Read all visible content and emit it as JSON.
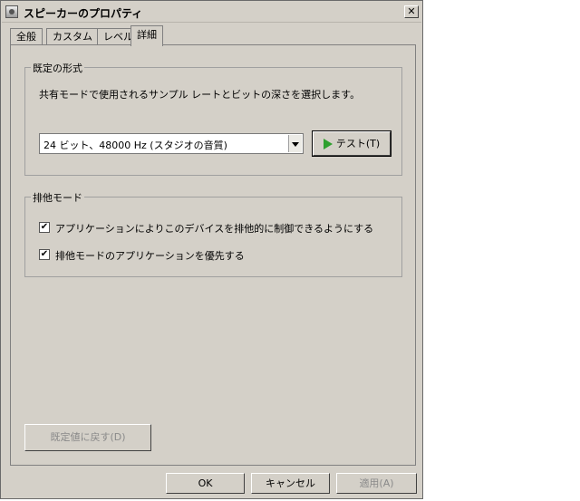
{
  "window": {
    "title": "スピーカーのプロパティ",
    "close_glyph": "✕"
  },
  "tabs": [
    {
      "label": "全般"
    },
    {
      "label": "カスタム"
    },
    {
      "label": "レベル"
    },
    {
      "label": "詳細",
      "active": true
    }
  ],
  "default_format": {
    "legend": "既定の形式",
    "description": "共有モードで使用されるサンプル レートとビットの深さを選択します。",
    "selected_value": "24 ビット、48000 Hz (スタジオの音質)",
    "test_button_label": "テスト(T)",
    "test_icon": "play-icon"
  },
  "exclusive_mode": {
    "legend": "排他モード",
    "options": [
      {
        "label": "アプリケーションによりこのデバイスを排他的に制御できるようにする",
        "checked": true
      },
      {
        "label": "排他モードのアプリケーションを優先する",
        "checked": true
      }
    ],
    "check_glyph": "✔"
  },
  "restore_defaults_label": "既定値に戻す(D)",
  "footer": {
    "ok_label": "OK",
    "cancel_label": "キャンセル",
    "apply_label": "適用(A)"
  }
}
